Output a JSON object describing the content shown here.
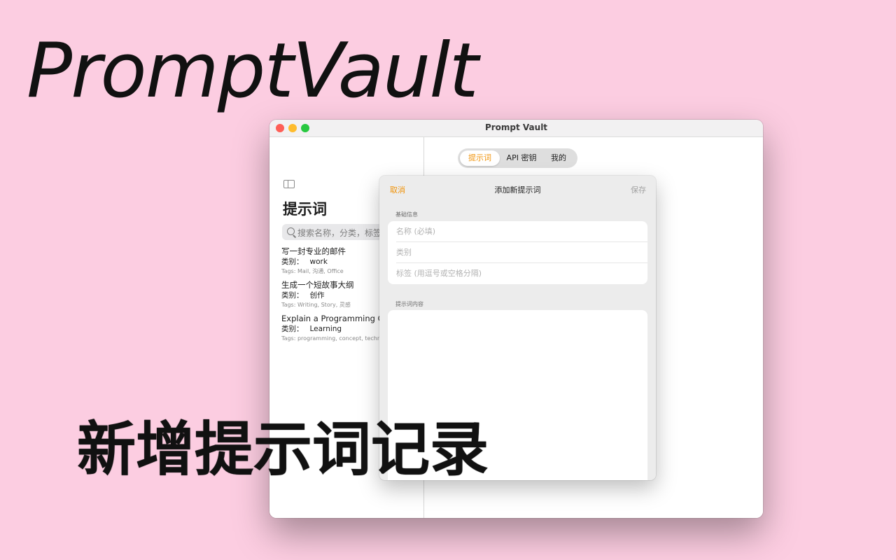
{
  "hero": {
    "title": "PromptVault"
  },
  "window": {
    "title": "Prompt Vault"
  },
  "sidebar": {
    "heading": "提示词",
    "search_placeholder": "搜索名称，分类，标签...",
    "items": [
      {
        "title": "写一封专业的邮件",
        "category_label": "类别：",
        "category": "work",
        "tags": "Tags: Mail, 沟通, Office"
      },
      {
        "title": "生成一个短故事大纲",
        "category_label": "类别：",
        "category": "创作",
        "tags": "Tags: Writing, Story, 灵感"
      },
      {
        "title": "Explain a Programming Concept",
        "category_label": "类别：",
        "category": "Learning",
        "tags": "Tags: programming, concept, technology"
      }
    ]
  },
  "tabs": [
    {
      "label": "提示词",
      "active": true
    },
    {
      "label": "API 密钥",
      "active": false
    },
    {
      "label": "我的",
      "active": false
    }
  ],
  "sheet": {
    "cancel": "取消",
    "title": "添加新提示词",
    "save": "保存",
    "section_basic": "基础信息",
    "fields": {
      "name_placeholder": "名称 (必填)",
      "category_placeholder": "类别",
      "tags_placeholder": "标签 (用逗号或空格分隔)"
    },
    "section_content": "提示词内容"
  },
  "caption": "新增提示词记录",
  "colors": {
    "accent": "#f0930a",
    "background": "#fccde1"
  }
}
